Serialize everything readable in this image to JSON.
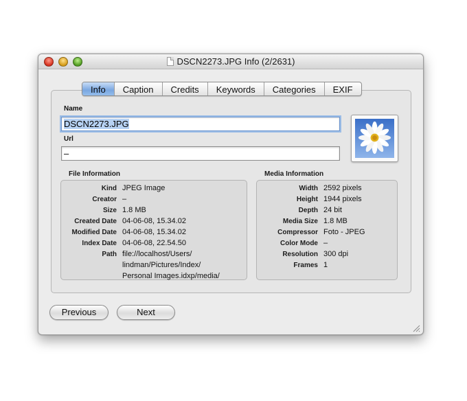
{
  "window": {
    "title": "DSCN2273.JPG Info (2/2631)"
  },
  "tabs": [
    "Info",
    "Caption",
    "Credits",
    "Keywords",
    "Categories",
    "EXIF"
  ],
  "active_tab": "Info",
  "name_section": {
    "name_label": "Name",
    "name_value": "DSCN2273.JPG",
    "url_label": "Url",
    "url_value": "–"
  },
  "thumbnail": {
    "icon": "flower-photo"
  },
  "file_information": {
    "title": "File Information",
    "rows": [
      {
        "key": "Kind",
        "value": "JPEG Image"
      },
      {
        "key": "Creator",
        "value": "–"
      },
      {
        "key": "Size",
        "value": "1.8 MB"
      },
      {
        "key": "Created Date",
        "value": "04-06-08, 15.34.02"
      },
      {
        "key": "Modified Date",
        "value": "04-06-08, 15.34.02"
      },
      {
        "key": "Index Date",
        "value": "04-06-08, 22.54.50"
      },
      {
        "key": "Path",
        "value": "file://localhost/Users/",
        "value2": "lindman/Pictures/Index/",
        "value3": "Personal Images.idxp/media/"
      }
    ]
  },
  "media_information": {
    "title": "Media Information",
    "rows": [
      {
        "key": "Width",
        "value": "2592 pixels"
      },
      {
        "key": "Height",
        "value": "1944 pixels"
      },
      {
        "key": "Depth",
        "value": "24 bit"
      },
      {
        "key": "Media Size",
        "value": "1.8 MB"
      },
      {
        "key": "Compressor",
        "value": "Foto - JPEG"
      },
      {
        "key": "Color Mode",
        "value": "–"
      },
      {
        "key": "Resolution",
        "value": "300 dpi"
      },
      {
        "key": "Frames",
        "value": "1"
      }
    ]
  },
  "buttons": {
    "previous": "Previous",
    "next": "Next"
  },
  "colors": {
    "active_tab": "#7aa7e0",
    "focus_ring": "#9cbde6",
    "close": "#d5301d",
    "minimize": "#d49a17",
    "zoom": "#4f9a20"
  }
}
